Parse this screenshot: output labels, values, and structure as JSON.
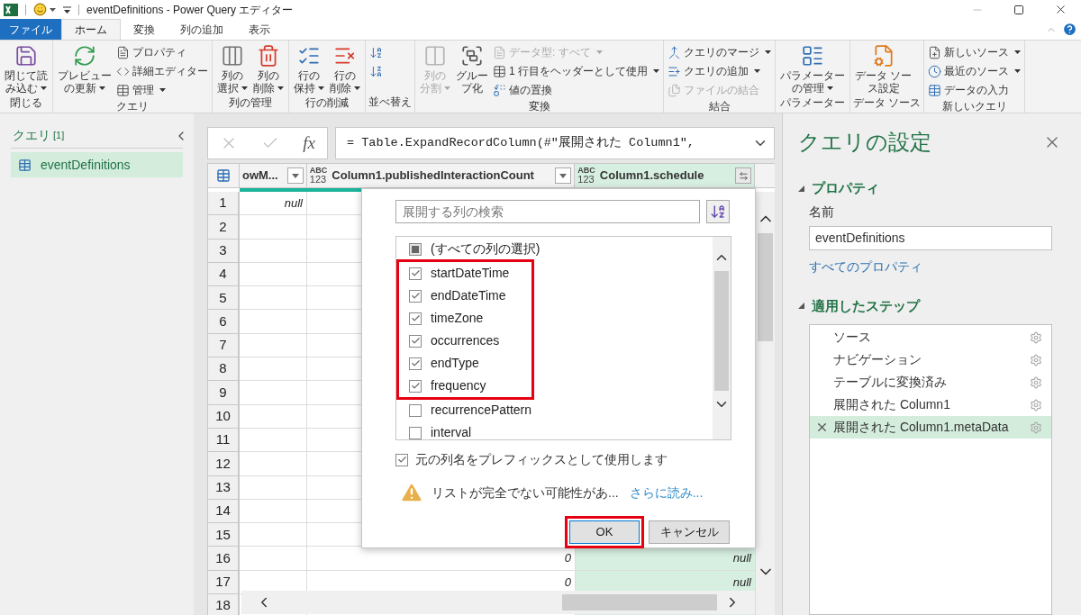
{
  "window": {
    "title": "eventDefinitions - Power Query エディター"
  },
  "tabs": [
    {
      "label": "ファイル",
      "kind": "file",
      "selected": false
    },
    {
      "label": "ホーム",
      "kind": "tab",
      "selected": true
    },
    {
      "label": "変換",
      "kind": "tab",
      "selected": false
    },
    {
      "label": "列の追加",
      "kind": "tab",
      "selected": false
    },
    {
      "label": "表示",
      "kind": "tab",
      "selected": false
    }
  ],
  "ribbon": {
    "groups": [
      {
        "label": "閉じる",
        "items": [
          {
            "kind": "large",
            "lines": [
              "閉じて読",
              "み込む"
            ],
            "dropdown": true,
            "disabled": false
          }
        ]
      },
      {
        "label": "クエリ",
        "items": [
          {
            "kind": "large",
            "lines": [
              "プレビュー",
              "の更新"
            ],
            "dropdown": true,
            "disabled": false
          },
          {
            "kind": "stack",
            "items": [
              {
                "label": "プロパティ",
                "dropdown": false,
                "disabled": false
              },
              {
                "label": "詳細エディター",
                "dropdown": false,
                "disabled": false
              },
              {
                "label": "管理",
                "dropdown": true,
                "disabled": false
              }
            ]
          }
        ]
      },
      {
        "label": "列の管理",
        "items": [
          {
            "kind": "large",
            "lines": [
              "列の",
              "選択"
            ],
            "dropdown": true,
            "disabled": false
          },
          {
            "kind": "large",
            "lines": [
              "列の",
              "削除"
            ],
            "dropdown": true,
            "disabled": false
          }
        ]
      },
      {
        "label": "行の削減",
        "items": [
          {
            "kind": "large",
            "lines": [
              "行の",
              "保持"
            ],
            "dropdown": true,
            "disabled": false
          },
          {
            "kind": "large",
            "lines": [
              "行の",
              "削除"
            ],
            "dropdown": true,
            "disabled": false
          }
        ]
      },
      {
        "label": "並べ替え",
        "items": [
          {
            "kind": "stack",
            "items": [
              {
                "dropdown": false,
                "disabled": false
              },
              {
                "dropdown": false,
                "disabled": false
              }
            ]
          }
        ]
      },
      {
        "label": "変換",
        "items": [
          {
            "kind": "large",
            "lines": [
              "列の",
              "分割"
            ],
            "dropdown": true,
            "disabled": true
          },
          {
            "kind": "large",
            "lines": [
              "グルー",
              "プ化"
            ],
            "dropdown": false,
            "disabled": false
          },
          {
            "kind": "stack",
            "items": [
              {
                "label": "データ型: すべて",
                "dropdown": true,
                "disabled": true
              },
              {
                "label": "1 行目をヘッダーとして使用",
                "dropdown": true,
                "disabled": false
              },
              {
                "label": "値の置換",
                "dropdown": false,
                "disabled": false
              }
            ]
          }
        ]
      },
      {
        "label": "結合",
        "items": [
          {
            "kind": "stack",
            "items": [
              {
                "label": "クエリのマージ",
                "dropdown": true,
                "disabled": false
              },
              {
                "label": "クエリの追加",
                "dropdown": true,
                "disabled": false
              },
              {
                "label": "ファイルの結合",
                "dropdown": false,
                "disabled": true
              }
            ]
          }
        ]
      },
      {
        "label": "パラメーター",
        "items": [
          {
            "kind": "large",
            "lines": [
              "パラメーター",
              "の管理"
            ],
            "dropdown": true,
            "disabled": false
          }
        ]
      },
      {
        "label": "データ ソース",
        "items": [
          {
            "kind": "large",
            "lines": [
              "データ ソー",
              "ス設定"
            ],
            "dropdown": false,
            "disabled": false
          }
        ]
      },
      {
        "label": "新しいクエリ",
        "items": [
          {
            "kind": "stack",
            "items": [
              {
                "label": "新しいソース",
                "dropdown": true,
                "disabled": false
              },
              {
                "label": "最近のソース",
                "dropdown": true,
                "disabled": false
              },
              {
                "label": "データの入力",
                "dropdown": false,
                "disabled": false
              }
            ]
          }
        ]
      }
    ]
  },
  "queries": {
    "title": "クエリ",
    "count": "[1]",
    "items": [
      {
        "label": "eventDefinitions",
        "selected": true
      }
    ]
  },
  "formula_bar": {
    "fx": "fx",
    "formula": "= Table.ExpandRecordColumn(#\"展開された Column1\","
  },
  "grid": {
    "columns": [
      {
        "label": "owM...",
        "kind": "filter",
        "selected": false
      },
      {
        "type": [
          "ABC",
          "123"
        ],
        "label": "Column1.publishedInteractionCount",
        "kind": "filter",
        "selected": false
      },
      {
        "type": [
          "ABC",
          "123"
        ],
        "label": "Column1.schedule",
        "kind": "expand",
        "selected": true
      }
    ],
    "rows": [
      {
        "number": "1",
        "cells": [
          "null",
          null,
          null
        ]
      },
      {
        "number": "2"
      },
      {
        "number": "3"
      },
      {
        "number": "4"
      },
      {
        "number": "5"
      },
      {
        "number": "6"
      },
      {
        "number": "7"
      },
      {
        "number": "8"
      },
      {
        "number": "9"
      },
      {
        "number": "10"
      },
      {
        "number": "11"
      },
      {
        "number": "12"
      },
      {
        "number": "13"
      },
      {
        "number": "14"
      },
      {
        "number": "15"
      },
      {
        "number": "16",
        "cells": [
          null,
          "0",
          "null"
        ]
      },
      {
        "number": "17",
        "cells": [
          null,
          "0",
          "null"
        ]
      },
      {
        "number": "18"
      }
    ]
  },
  "expand_dialog": {
    "search": {
      "placeholder": "展開する列の検索"
    },
    "columns": [
      {
        "label": "(すべての列の選択)",
        "checked": false,
        "indeterminate": true,
        "highlighted": false
      },
      {
        "label": "startDateTime",
        "checked": true,
        "indeterminate": false,
        "highlighted": true
      },
      {
        "label": "endDateTime",
        "checked": true,
        "indeterminate": false,
        "highlighted": true
      },
      {
        "label": "timeZone",
        "checked": true,
        "indeterminate": false,
        "highlighted": true
      },
      {
        "label": "occurrences",
        "checked": true,
        "indeterminate": false,
        "highlighted": true
      },
      {
        "label": "endType",
        "checked": true,
        "indeterminate": false,
        "highlighted": true
      },
      {
        "label": "frequency",
        "checked": true,
        "indeterminate": false,
        "highlighted": true
      },
      {
        "label": "recurrencePattern",
        "checked": false,
        "indeterminate": false,
        "highlighted": false
      },
      {
        "label": "interval",
        "checked": false,
        "indeterminate": false,
        "highlighted": false
      }
    ],
    "prefix": {
      "label": "元の列名をプレフィックスとして使用します",
      "checked": true
    },
    "warning": {
      "text": "リストが完全でない可能性があ...",
      "link": "さらに読み..."
    },
    "buttons": [
      {
        "label": "OK",
        "default": true,
        "highlighted": true
      },
      {
        "label": "キャンセル",
        "default": false,
        "highlighted": false
      }
    ]
  },
  "query_settings": {
    "title": "クエリの設定",
    "properties": {
      "heading": "プロパティ",
      "name_label": "名前",
      "name_value": "eventDefinitions",
      "link": "すべてのプロパティ"
    },
    "steps": {
      "heading": "適用したステップ",
      "items": [
        {
          "label": "ソース",
          "selected": false
        },
        {
          "label": "ナビゲーション",
          "selected": false
        },
        {
          "label": "テーブルに変換済み",
          "selected": false
        },
        {
          "label": "展開された Column1",
          "selected": false
        },
        {
          "label": "展開された Column1.metaData",
          "selected": true
        }
      ]
    }
  }
}
